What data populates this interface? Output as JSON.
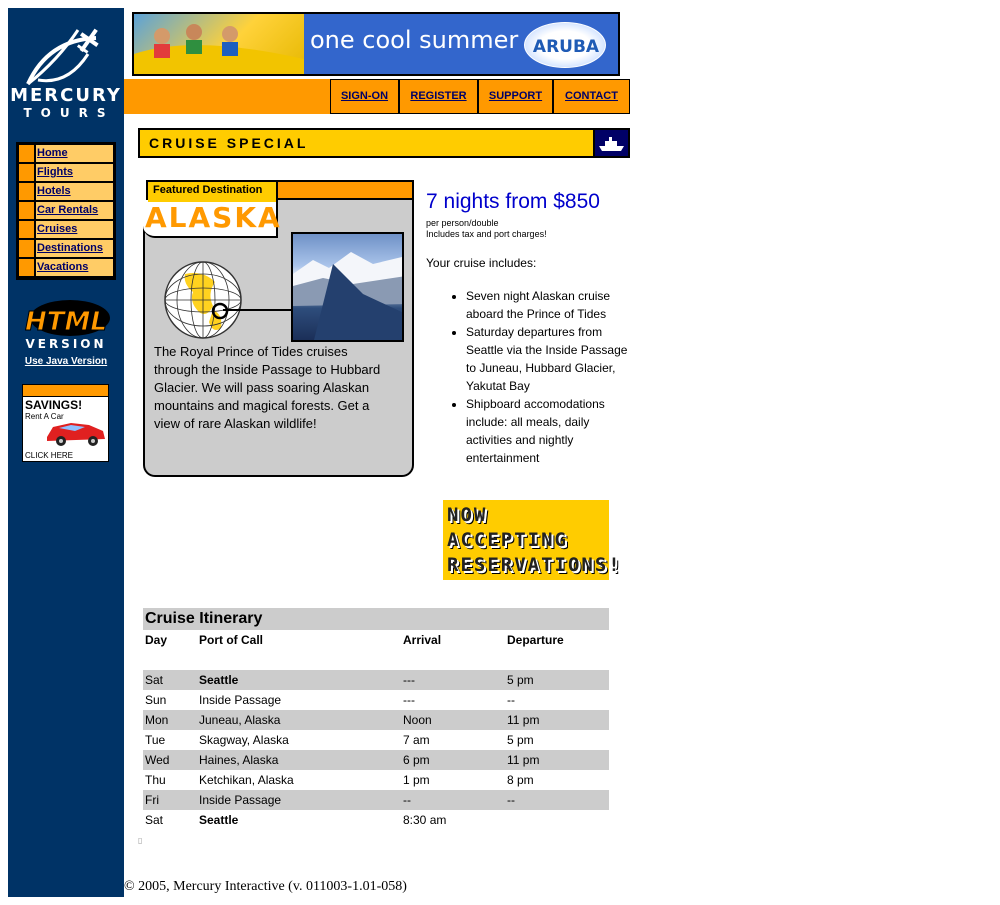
{
  "sidebar": {
    "logo_line1": "MERCURY",
    "logo_line2": "TOURS",
    "nav": [
      {
        "label": "Home"
      },
      {
        "label": "Flights"
      },
      {
        "label": "Hotels"
      },
      {
        "label": "Car Rentals"
      },
      {
        "label": "Cruises"
      },
      {
        "label": "Destinations"
      },
      {
        "label": "Vacations"
      }
    ],
    "badge_line1": "HTML",
    "badge_line2": "VERSION",
    "java_link": "Use Java Version",
    "ad": {
      "title": "SAVINGS!",
      "subtitle": "Rent A Car",
      "cta": "CLICK HERE"
    }
  },
  "banner": {
    "text": "one cool summer",
    "brand": "ARUBA"
  },
  "topnav": {
    "items": [
      "SIGN-ON",
      "REGISTER",
      "SUPPORT",
      "CONTACT"
    ]
  },
  "section_title": "CRUISE SPECIAL",
  "featured": {
    "label": "Featured Destination",
    "name": "ALASKA",
    "description": "The Royal Prince of Tides cruises through the Inside Passage to Hubbard Glacier. We will pass soaring Alaskan mountains and magical forests. Get a view of rare Alaskan wildlife!"
  },
  "offer": {
    "price": "7 nights from $850",
    "sub1": "per person/double",
    "sub2": "Includes tax and port charges!",
    "includes_title": "Your cruise includes:",
    "includes": [
      "Seven night Alaskan cruise aboard the Prince of Tides",
      "Saturday departures from Seattle via the Inside Passage to Juneau, Hubbard Glacier, Yakutat Bay",
      "Shipboard accomodations include: all meals, daily activities and nightly entertainment"
    ],
    "now_accepting": "NOW\nACCEPTING\nRESERVATIONS!"
  },
  "itinerary": {
    "title": "Cruise Itinerary",
    "headers": [
      "Day",
      "Port of Call",
      "Arrival",
      "Departure"
    ],
    "rows": [
      {
        "day": "Sat",
        "port": "Seattle",
        "arrival": "---",
        "departure": "5 pm"
      },
      {
        "day": "Sun",
        "port": "Inside Passage",
        "arrival": "---",
        "departure": "--"
      },
      {
        "day": "Mon",
        "port": "Juneau, Alaska",
        "arrival": "Noon",
        "departure": "11 pm"
      },
      {
        "day": "Tue",
        "port": "Skagway, Alaska",
        "arrival": "7 am",
        "departure": "5 pm"
      },
      {
        "day": "Wed",
        "port": "Haines, Alaska",
        "arrival": "6 pm",
        "departure": "11 pm"
      },
      {
        "day": "Thu",
        "port": "Ketchikan, Alaska",
        "arrival": "1 pm",
        "departure": "8 pm"
      },
      {
        "day": "Fri",
        "port": "Inside Passage",
        "arrival": "--",
        "departure": "--"
      },
      {
        "day": "Sat",
        "port": "Seattle",
        "arrival": "8:30 am",
        "departure": ""
      }
    ]
  },
  "footer": "© 2005, Mercury Interactive (v. 011003-1.01-058)",
  "colors": {
    "sidebar": "#003366",
    "orange": "#FF9900",
    "yellow": "#FFCC00",
    "price_blue": "#0000CC"
  }
}
